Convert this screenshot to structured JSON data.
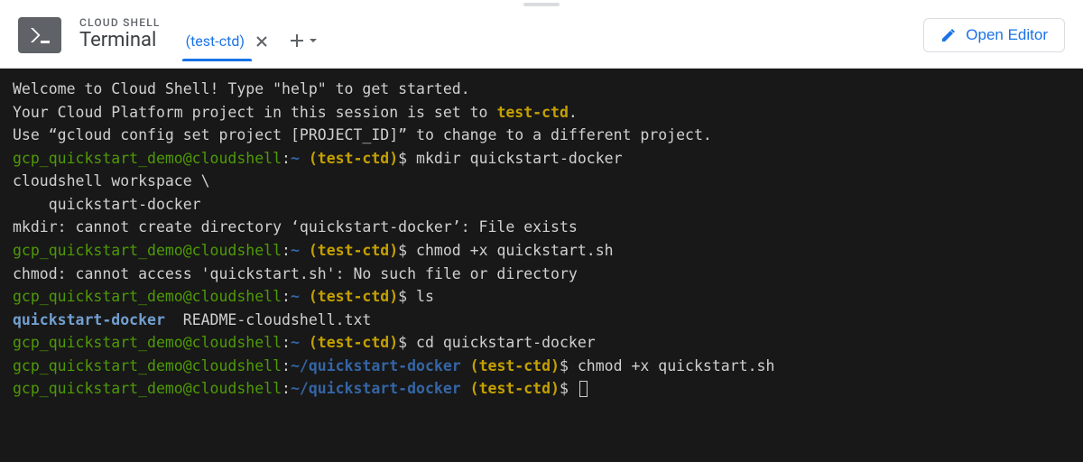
{
  "header": {
    "label": "CLOUD SHELL",
    "title": "Terminal",
    "tab_name": "(test-ctd)",
    "open_editor": "Open Editor"
  },
  "welcome": {
    "line1": "Welcome to Cloud Shell! Type \"help\" to get started.",
    "line2a": "Your Cloud Platform project in this session is set to ",
    "line2b": "test-ctd",
    "line2c": ".",
    "line3": "Use “gcloud config set project [PROJECT_ID]” to change to a different project."
  },
  "prompt": {
    "user_host": "gcp_quickstart_demo@cloudshell",
    "colon": ":",
    "home": "~",
    "path2": "~/quickstart-docker",
    "project": "(test-ctd)",
    "dollar": "$"
  },
  "cmds": {
    "mkdir": " mkdir quickstart-docker",
    "chmod1": " chmod +x quickstart.sh",
    "ls": " ls",
    "cd": " cd quickstart-docker",
    "chmod2": " chmod +x quickstart.sh",
    "empty": " "
  },
  "output": {
    "ws1": "cloudshell workspace \\",
    "ws2": "    quickstart-docker",
    "mkdir_err": "mkdir: cannot create directory ‘quickstart-docker’: File exists",
    "chmod_err": "chmod: cannot access 'quickstart.sh': No such file or directory",
    "ls_dir": "quickstart-docker",
    "ls_file": "  README-cloudshell.txt"
  }
}
